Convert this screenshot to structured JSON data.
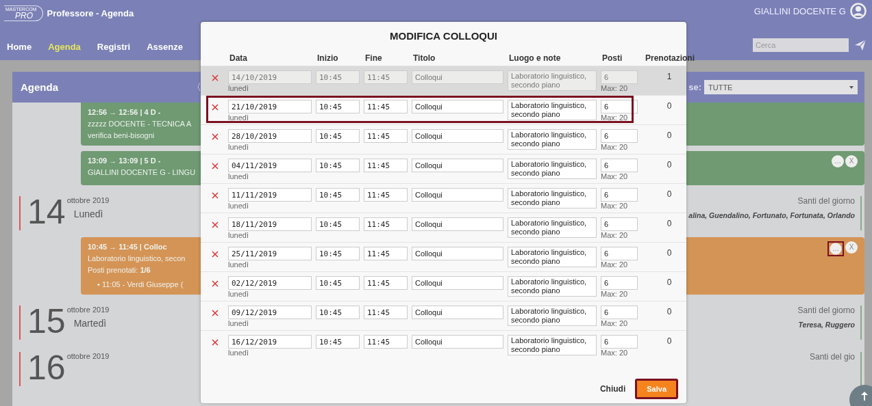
{
  "header": {
    "logo": {
      "top": "MASTERCOM",
      "bottom": "PRO"
    },
    "title": "Professore - Agenda",
    "nav": [
      {
        "label": "Home",
        "selected": false
      },
      {
        "label": "Agenda",
        "selected": true
      },
      {
        "label": "Registri",
        "selected": false
      },
      {
        "label": "Assenze",
        "selected": false
      }
    ],
    "user": "GIALLINI DOCENTE G",
    "search": {
      "placeholder": "Cerca"
    }
  },
  "agenda_bar": {
    "title": "Agenda",
    "prev": "〈",
    "filter_label": "se:",
    "filter_value": "TUTTE"
  },
  "agenda": [
    {
      "kind": "event",
      "color": "#6f9a72",
      "lines": [
        "12:56 → 12:56 | 4 D -",
        "zzzzz DOCENTE - TECNICA A",
        "verifica beni-bisogni"
      ]
    },
    {
      "kind": "event",
      "color": "#6f9a72",
      "lines": [
        "13:09 → 13:09 | 5 D -",
        "GIALLINI DOCENTE G - LINGU"
      ],
      "actions": [
        "…",
        "X"
      ],
      "highlight_action": false
    },
    {
      "kind": "day",
      "number": "14",
      "month": "ottobre 2019",
      "weekday": "Lunedì",
      "saints_label": "Santi del giorno",
      "saints": "alina, Guendalino, Fortunato, Fortunata, Orlando"
    },
    {
      "kind": "event",
      "color": "#d49456",
      "lines": [
        "10:45 → 11:45 | Colloc",
        "Laboratorio linguistico, secon",
        "Posti prenotati: **1/6**",
        "• 11:05 - Verdi Giuseppe ("
      ],
      "actions": [
        "…",
        "X"
      ],
      "highlight_action": true
    },
    {
      "kind": "day",
      "number": "15",
      "month": "ottobre 2019",
      "weekday": "Martedì",
      "saints_label": "Santi del giorno",
      "saints": "Teresa, Ruggero"
    },
    {
      "kind": "day",
      "number": "16",
      "month": "ottobre 2019",
      "saints_label": "Santi del gio"
    }
  ],
  "modal": {
    "title": "MODIFICA COLLOQUI",
    "columns": [
      "Data",
      "Inizio",
      "Fine",
      "Titolo",
      "Luogo e note",
      "Posti",
      "Prenotazioni"
    ],
    "rows": [
      {
        "date": "14/10/2019",
        "weekday": "lunedì",
        "start": "10:45",
        "end": "11:45",
        "title": "Colloqui",
        "place": "Laboratorio linguistico, secondo piano",
        "seats": "6",
        "max": "Max: 20",
        "bookings": "1",
        "disabled": true,
        "highlight": false
      },
      {
        "date": "21/10/2019",
        "weekday": "lunedì",
        "start": "10:45",
        "end": "11:45",
        "title": "Colloqui",
        "place": "Laboratorio linguistico, secondo piano",
        "seats": "6",
        "max": "Max: 20",
        "bookings": "0",
        "disabled": false,
        "highlight": true
      },
      {
        "date": "28/10/2019",
        "weekday": "lunedì",
        "start": "10:45",
        "end": "11:45",
        "title": "Colloqui",
        "place": "Laboratorio linguistico, secondo piano",
        "seats": "6",
        "max": "Max: 20",
        "bookings": "0",
        "disabled": false,
        "highlight": false
      },
      {
        "date": "04/11/2019",
        "weekday": "lunedì",
        "start": "10:45",
        "end": "11:45",
        "title": "Colloqui",
        "place": "Laboratorio linguistico, secondo piano",
        "seats": "6",
        "max": "Max: 20",
        "bookings": "0",
        "disabled": false,
        "highlight": false
      },
      {
        "date": "11/11/2019",
        "weekday": "lunedì",
        "start": "10:45",
        "end": "11:45",
        "title": "Colloqui",
        "place": "Laboratorio linguistico, secondo piano",
        "seats": "6",
        "max": "Max: 20",
        "bookings": "0",
        "disabled": false,
        "highlight": false
      },
      {
        "date": "18/11/2019",
        "weekday": "lunedì",
        "start": "10:45",
        "end": "11:45",
        "title": "Colloqui",
        "place": "Laboratorio linguistico, secondo piano",
        "seats": "6",
        "max": "Max: 20",
        "bookings": "0",
        "disabled": false,
        "highlight": false
      },
      {
        "date": "25/11/2019",
        "weekday": "lunedì",
        "start": "10:45",
        "end": "11:45",
        "title": "Colloqui",
        "place": "Laboratorio linguistico, secondo piano",
        "seats": "6",
        "max": "Max: 20",
        "bookings": "0",
        "disabled": false,
        "highlight": false
      },
      {
        "date": "02/12/2019",
        "weekday": "lunedì",
        "start": "10:45",
        "end": "11:45",
        "title": "Colloqui",
        "place": "Laboratorio linguistico, secondo piano",
        "seats": "6",
        "max": "Max: 20",
        "bookings": "0",
        "disabled": false,
        "highlight": false
      },
      {
        "date": "09/12/2019",
        "weekday": "lunedì",
        "start": "10:45",
        "end": "11:45",
        "title": "Colloqui",
        "place": "Laboratorio linguistico, secondo piano",
        "seats": "6",
        "max": "Max: 20",
        "bookings": "0",
        "disabled": false,
        "highlight": false
      },
      {
        "date": "16/12/2019",
        "weekday": "lunedì",
        "start": "10:45",
        "end": "11:45",
        "title": "Colloqui",
        "place": "Laboratorio linguistico, secondo piano",
        "seats": "6",
        "max": "Max: 20",
        "bookings": "0",
        "disabled": false,
        "highlight": false
      }
    ],
    "close": "Chiudi",
    "save": {
      "label": "Salva",
      "highlight": true
    }
  }
}
